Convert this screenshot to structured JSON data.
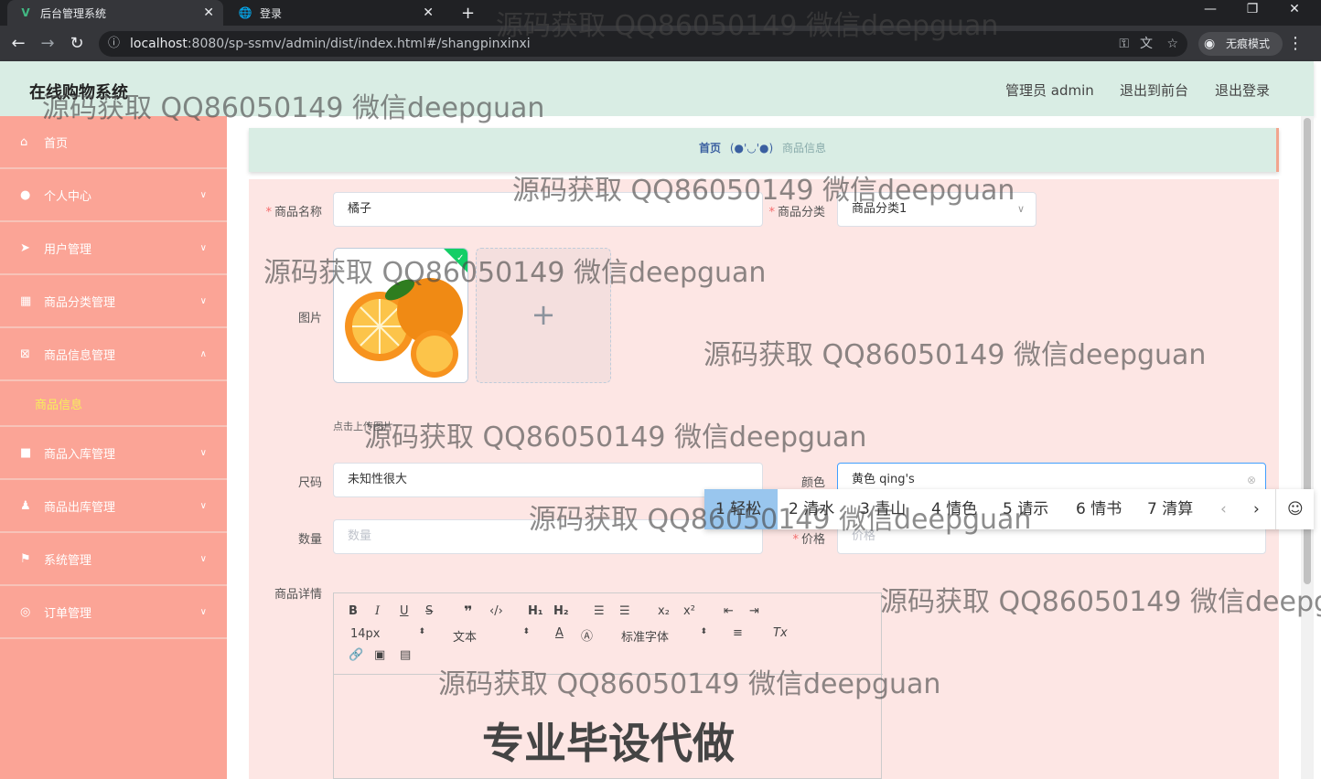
{
  "browser": {
    "tabs": [
      {
        "title": "后台管理系统",
        "icon": "V"
      },
      {
        "title": "登录",
        "icon": "globe-icon"
      }
    ],
    "new_tab": "+",
    "url_host": "localhost",
    "url_rest": ":8080/sp-ssmv/admin/dist/index.html#/shangpinxinxi",
    "incognito_label": "无痕模式",
    "window_controls": [
      "—",
      "❐",
      "✕"
    ]
  },
  "header": {
    "title": "在线购物系统",
    "admin": "管理员 admin",
    "to_front": "退出到前台",
    "logout": "退出登录"
  },
  "sidebar": {
    "items": [
      {
        "label": "首页",
        "icon": "home-icon",
        "arrow": ""
      },
      {
        "label": "个人中心",
        "icon": "user-icon",
        "arrow": "∨"
      },
      {
        "label": "用户管理",
        "icon": "send-icon",
        "arrow": "∨"
      },
      {
        "label": "商品分类管理",
        "icon": "grid-icon",
        "arrow": "∨"
      },
      {
        "label": "商品信息管理",
        "icon": "delete-box-icon",
        "arrow": "∧"
      },
      {
        "label": "商品入库管理",
        "icon": "camera-icon",
        "arrow": "∨"
      },
      {
        "label": "商品出库管理",
        "icon": "person-icon",
        "arrow": "∨"
      },
      {
        "label": "系统管理",
        "icon": "flag-icon",
        "arrow": "∨"
      },
      {
        "label": "订单管理",
        "icon": "compass-icon",
        "arrow": "∨"
      }
    ],
    "sub_item": "商品信息"
  },
  "breadcrumb": {
    "home": "首页",
    "face": "(●'◡'●)",
    "current": "商品信息"
  },
  "form": {
    "name_label": "商品名称",
    "name_value": "橘子",
    "category_label": "商品分类",
    "category_value": "商品分类1",
    "image_label": "图片",
    "upload_hint": "点击上传图片",
    "size_label": "尺码",
    "size_value": "未知性很大",
    "color_label": "颜色",
    "color_value": "黄色 qing's",
    "qty_label": "数量",
    "qty_placeholder": "数量",
    "price_label": "价格",
    "price_placeholder": "价格",
    "detail_label": "商品详情"
  },
  "editor": {
    "font_size": "14px",
    "text_type": "文本",
    "font_family": "标准字体",
    "content_text": "专业毕设代做"
  },
  "ime": {
    "candidates": [
      "1 轻松",
      "2 清水",
      "3 青山",
      "4 情色",
      "5 请示",
      "6 情书",
      "7 清算"
    ]
  },
  "watermark": "源码获取 QQ86050149 微信deepguan",
  "colors": {
    "sidebar": "#fba496",
    "header": "#d9ede4",
    "form_bg": "#fde6e4",
    "submenu_text": "#f7ef5b",
    "required": "#f56c6c"
  }
}
